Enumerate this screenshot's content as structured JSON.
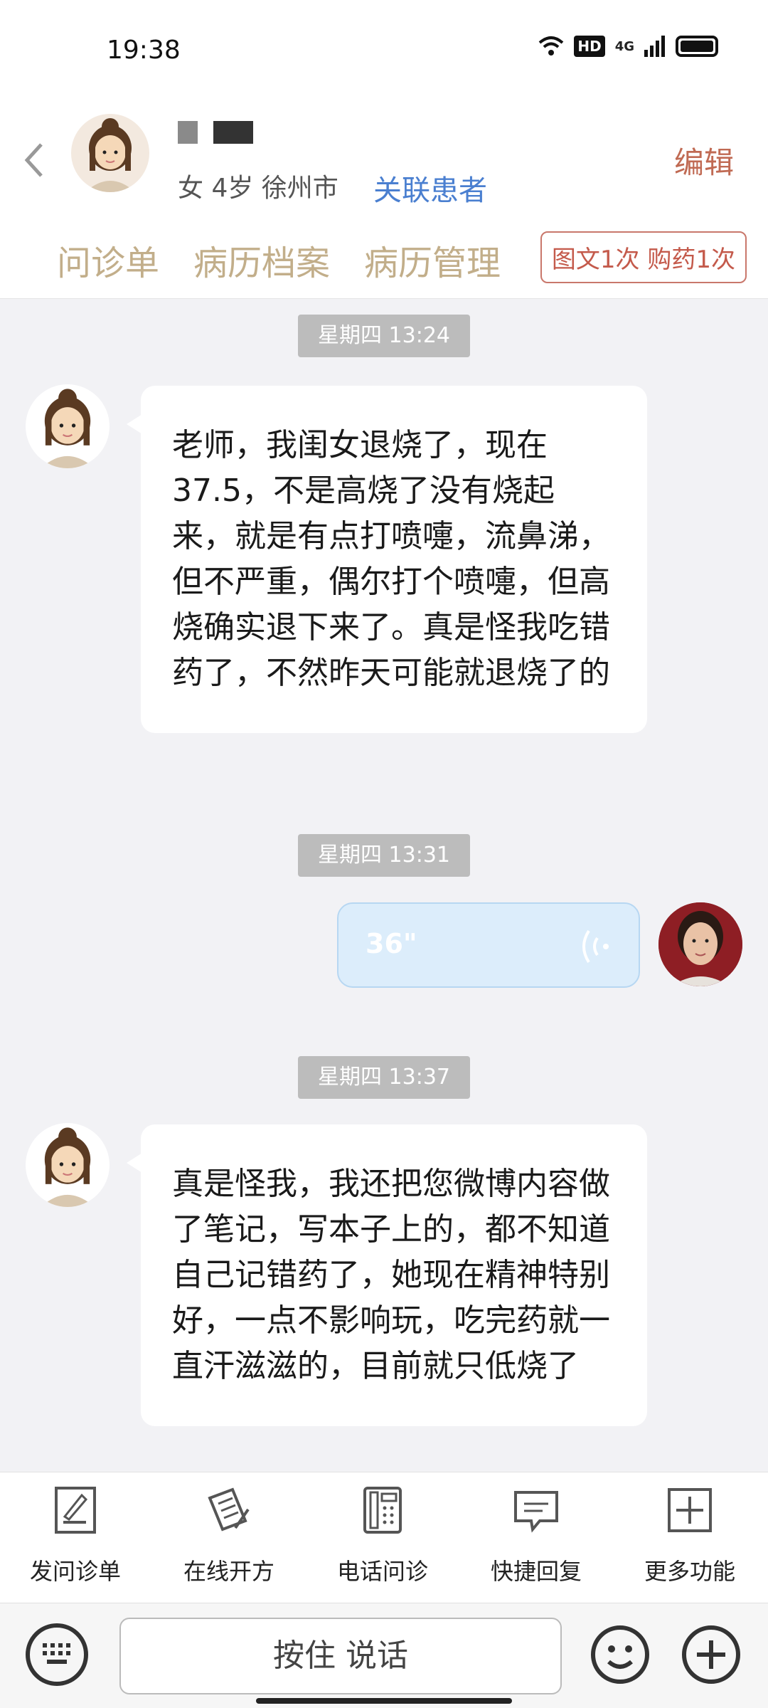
{
  "status_bar": {
    "time": "19:38",
    "hd_badge": "HD",
    "network": "4G"
  },
  "header": {
    "patient_info": "女 4岁  徐州市",
    "relate_link": "关联患者",
    "edit_label": "编辑",
    "tabs": [
      "问诊单",
      "病历档案",
      "病历管理"
    ],
    "service_badge": "图文1次 购药1次"
  },
  "chat": {
    "messages": [
      {
        "timestamp": "星期四 13:24",
        "text": "老师，我闺女退烧了，现在37.5，不是高烧了没有烧起来，就是有点打喷嚏，流鼻涕，但不严重，偶尔打个喷嚏，但高烧确实退下来了。真是怪我吃错药了，不然昨天可能就退烧了的"
      },
      {
        "timestamp": "星期四 13:31",
        "voice_duration": "36\""
      },
      {
        "timestamp": "星期四 13:37",
        "text": "真是怪我，我还把您微博内容做了笔记，写本子上的，都不知道自己记错药了，她现在精神特别好，一点不影响玩，吃完药就一直汗滋滋的，目前就只低烧了"
      }
    ]
  },
  "toolbar": {
    "items": [
      {
        "label": "发问诊单",
        "icon": "form-pen-icon"
      },
      {
        "label": "在线开方",
        "icon": "prescription-icon"
      },
      {
        "label": "电话问诊",
        "icon": "phone-icon"
      },
      {
        "label": "快捷回复",
        "icon": "chat-bubble-icon"
      },
      {
        "label": "更多功能",
        "icon": "plus-square-icon"
      }
    ]
  },
  "input_bar": {
    "talk_label": "按住 说话"
  },
  "colors": {
    "accent_tab": "#c2ae8a",
    "edit": "#c06a53",
    "link": "#4a7fd0",
    "voice_bubble": "#dcedfb"
  }
}
